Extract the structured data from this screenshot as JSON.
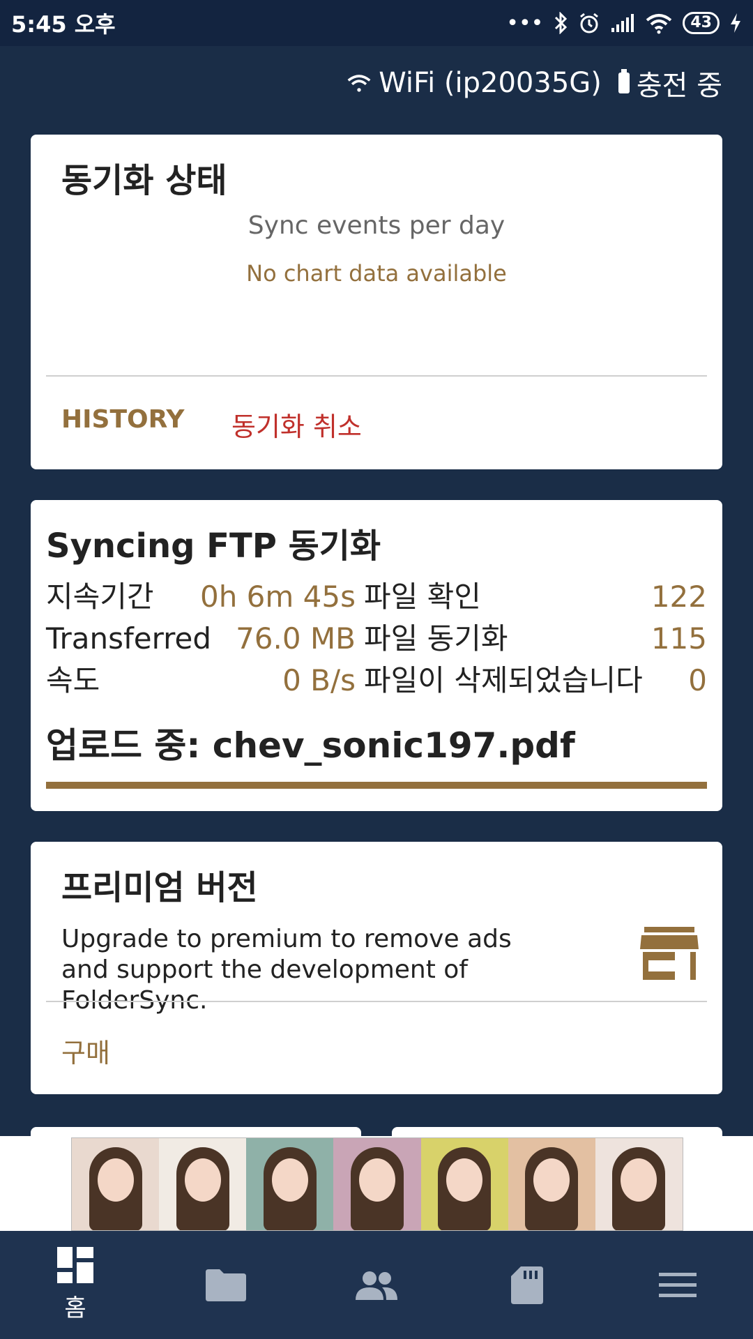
{
  "status_bar": {
    "time": "5:45 오후",
    "battery_level": "43",
    "icons": [
      "more-dots-icon",
      "bluetooth-icon",
      "alarm-icon",
      "signal-icon",
      "wifi-icon",
      "battery-icon",
      "charging-icon"
    ]
  },
  "connection": {
    "wifi_label": "WiFi (ip20035G)",
    "charging_label": "충전 중"
  },
  "sync_status_card": {
    "title": "동기화 상태",
    "chart_title": "Sync events per day",
    "no_data": "No chart data available",
    "history_label": "HISTORY",
    "cancel_label": "동기화 취소"
  },
  "syncing_card": {
    "title": "Syncing FTP 동기화",
    "left_stats": [
      {
        "label": "지속기간",
        "value": "0h 6m 45s"
      },
      {
        "label": "Transferred",
        "value": "76.0 MB"
      },
      {
        "label": "속도",
        "value": "0 B/s"
      }
    ],
    "right_stats": [
      {
        "label": "파일 확인",
        "value": "122"
      },
      {
        "label": "파일 동기화",
        "value": "115"
      },
      {
        "label": "파일이 삭제되었습니다",
        "value": "0"
      }
    ],
    "uploading": "업로드 중: chev_sonic197.pdf",
    "progress": 1.0
  },
  "premium_card": {
    "title": "프리미엄 버전",
    "description": "Upgrade to premium to remove ads and support the development of FolderSync.",
    "buy_label": "구매",
    "icon": "store-icon"
  },
  "bottom_nav": {
    "items": [
      {
        "icon": "dashboard-icon",
        "label": "홈",
        "active": true
      },
      {
        "icon": "folder-icon",
        "label": ""
      },
      {
        "icon": "accounts-icon",
        "label": ""
      },
      {
        "icon": "sd-card-icon",
        "label": ""
      },
      {
        "icon": "menu-icon",
        "label": ""
      }
    ]
  },
  "colors": {
    "background": "#1a2d47",
    "accent": "#93703d",
    "cancel": "#c0302b",
    "nav_background": "#1f3350"
  }
}
